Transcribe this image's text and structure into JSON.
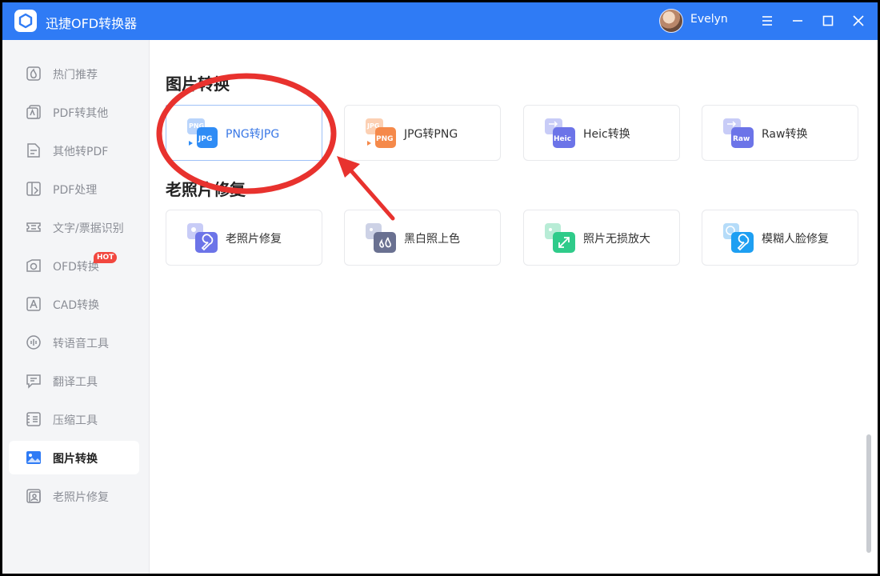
{
  "app": {
    "title": "迅捷OFD转换器",
    "username": "Evelyn"
  },
  "window_controls": [
    "menu-icon",
    "minimize-icon",
    "maximize-icon",
    "close-icon"
  ],
  "sidebar": {
    "items": [
      {
        "label": "热门推荐",
        "icon": "hot-icon"
      },
      {
        "label": "PDF转其他",
        "icon": "pdf-to-other-icon"
      },
      {
        "label": "其他转PDF",
        "icon": "other-to-pdf-icon"
      },
      {
        "label": "PDF处理",
        "icon": "pdf-process-icon"
      },
      {
        "label": "文字/票据识别",
        "icon": "ocr-icon"
      },
      {
        "label": "OFD转换",
        "icon": "ofd-icon",
        "badge": "HOT"
      },
      {
        "label": "CAD转换",
        "icon": "cad-icon"
      },
      {
        "label": "转语音工具",
        "icon": "voice-icon"
      },
      {
        "label": "翻译工具",
        "icon": "translate-icon"
      },
      {
        "label": "压缩工具",
        "icon": "compress-icon"
      },
      {
        "label": "图片转换",
        "icon": "image-icon",
        "active": true
      },
      {
        "label": "老照片修复",
        "icon": "photo-repair-icon"
      }
    ]
  },
  "sections": [
    {
      "title": "图片转换",
      "cards": [
        {
          "label": "PNG转JPG",
          "icon_text_back": "PNG",
          "icon_text_front": "JPG",
          "highlighted": true
        },
        {
          "label": "JPG转PNG",
          "icon_text_back": "JPG",
          "icon_text_front": "PNG"
        },
        {
          "label": "Heic转换",
          "icon_text_front": "Heic"
        },
        {
          "label": "Raw转换",
          "icon_text_front": "Raw"
        }
      ]
    },
    {
      "title": "老照片修复",
      "cards": [
        {
          "label": "老照片修复",
          "icon": "wrench-icon"
        },
        {
          "label": "黑白照上色",
          "icon": "drops-icon"
        },
        {
          "label": "照片无损放大",
          "icon": "expand-icon"
        },
        {
          "label": "模糊人脸修复",
          "icon": "wrench-icon"
        }
      ]
    }
  ],
  "colors": {
    "brand": "#2f7bf5",
    "annotation": "#e8322e",
    "hot": "#f2473f"
  }
}
